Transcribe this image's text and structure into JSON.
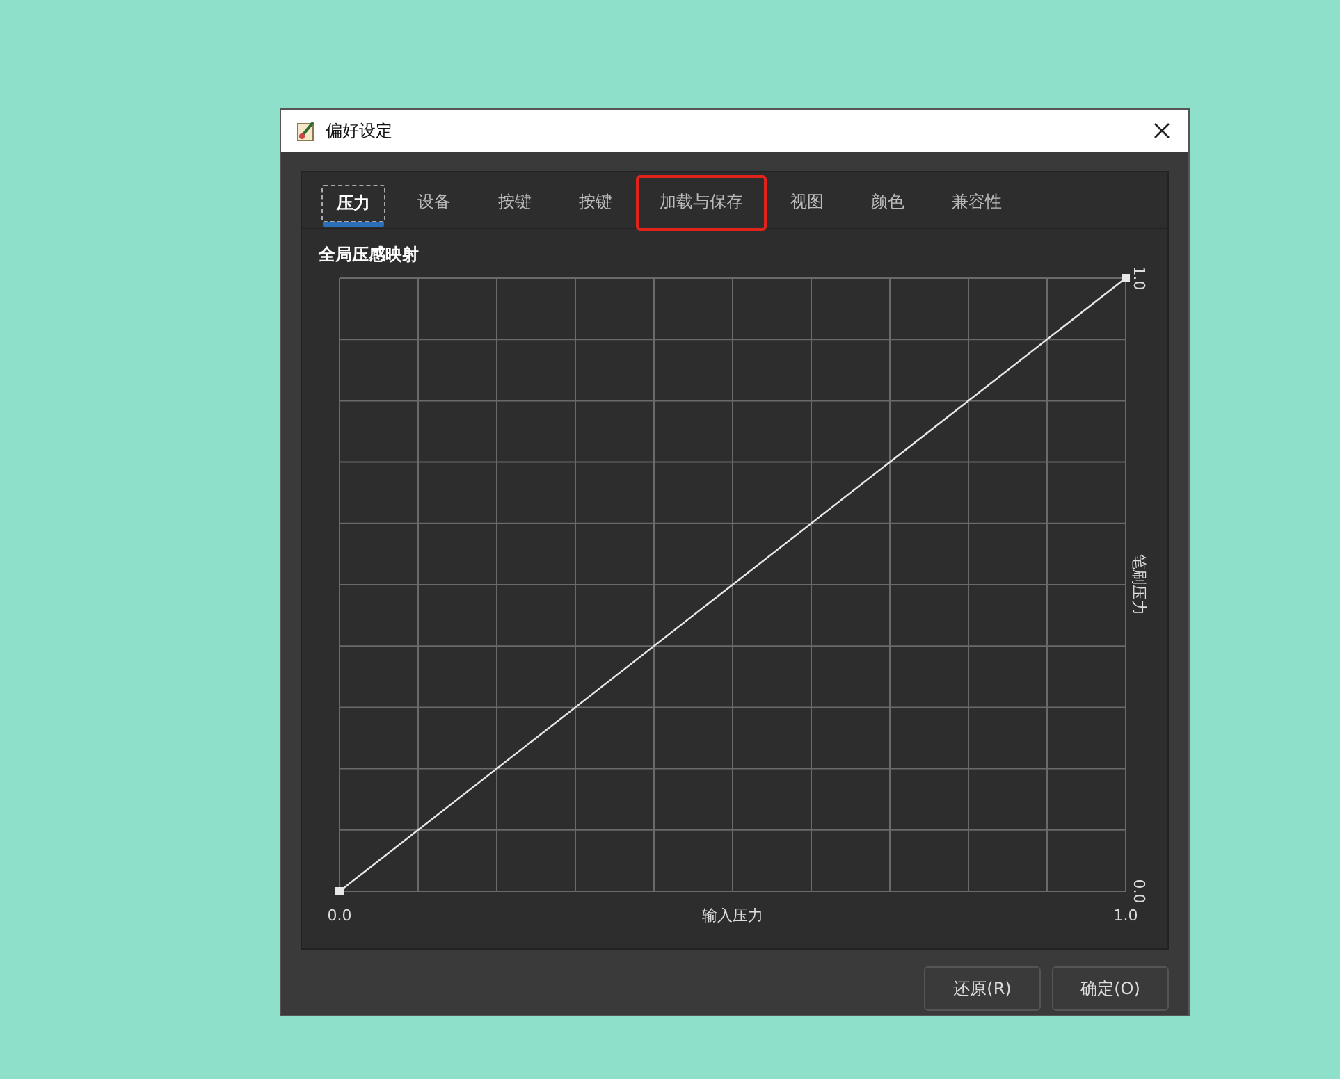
{
  "window": {
    "title": "偏好设定"
  },
  "tabs": [
    {
      "label": "压力",
      "selected": true,
      "highlighted": false
    },
    {
      "label": "设备",
      "selected": false,
      "highlighted": false
    },
    {
      "label": "按键",
      "selected": false,
      "highlighted": false
    },
    {
      "label": "按键",
      "selected": false,
      "highlighted": false
    },
    {
      "label": "加载与保存",
      "selected": false,
      "highlighted": true
    },
    {
      "label": "视图",
      "selected": false,
      "highlighted": false
    },
    {
      "label": "颜色",
      "selected": false,
      "highlighted": false
    },
    {
      "label": "兼容性",
      "selected": false,
      "highlighted": false
    }
  ],
  "section_title": "全局压感映射",
  "chart_data": {
    "type": "line",
    "xlabel": "输入压力",
    "ylabel": "笔刷压力",
    "x": [
      0,
      1
    ],
    "series": [
      {
        "marker": "square",
        "color": "#e8e8e8",
        "values": [
          0,
          1
        ]
      }
    ],
    "xlim": [
      0,
      1
    ],
    "ylim": [
      0,
      1
    ],
    "xticks": [
      {
        "value": 0,
        "label": "0.0"
      },
      {
        "value": 1,
        "label": "1.0"
      }
    ],
    "yticks": [
      {
        "value": 0,
        "label": "0.0"
      },
      {
        "value": 1,
        "label": "1.0"
      }
    ]
  },
  "buttons": [
    {
      "label": "还原(R)"
    },
    {
      "label": "确定(O)"
    }
  ]
}
